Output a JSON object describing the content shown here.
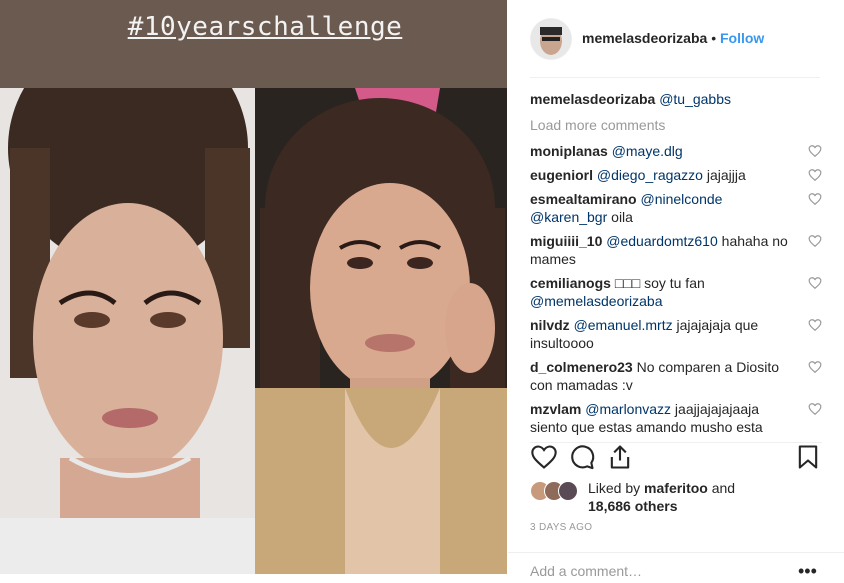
{
  "post": {
    "banner_text": "#10yearschallenge"
  },
  "header": {
    "username": "memelasdeorizaba",
    "separator": "•",
    "follow_label": "Follow"
  },
  "caption": {
    "username": "memelasdeorizaba",
    "mention": "@tu_gabbs"
  },
  "load_more_label": "Load more comments",
  "comments": [
    {
      "user": "moniplanas",
      "mention": "@maye.dlg",
      "text": ""
    },
    {
      "user": "eugeniorl",
      "mention": "@diego_ragazzo",
      "text": " jajajjja"
    },
    {
      "user": "esmealtamirano",
      "mention": "@ninelconde @karen_bgr",
      "text": " oila"
    },
    {
      "user": "miguiiii_10",
      "mention": "@eduardomtz610",
      "text": " hahaha no mames"
    },
    {
      "user": "cemilianogs",
      "mention": "",
      "text": "□□□ soy tu fan ",
      "mention_after": "@memelasdeorizaba"
    },
    {
      "user": "nilvdz",
      "mention": "@emanuel.mrtz",
      "text": " jajajajaja que insultoooo"
    },
    {
      "user": "d_colmenero23",
      "mention": "",
      "text": "No comparen a Diosito con mamadas :v"
    },
    {
      "user": "mzvlam",
      "mention": "@marlonvazz",
      "text": " jaajjajajajaaja siento que estas amando musho esta"
    }
  ],
  "likes": {
    "prefix": "Liked by ",
    "user": "maferitoo",
    "middle": " and",
    "count": "18,686 others"
  },
  "date": "3 DAYS AGO",
  "add_comment_placeholder": "Add a comment…",
  "more_icon_glyph": "•••",
  "icons": [
    "heart-icon",
    "comment-icon",
    "share-icon",
    "bookmark-icon"
  ]
}
